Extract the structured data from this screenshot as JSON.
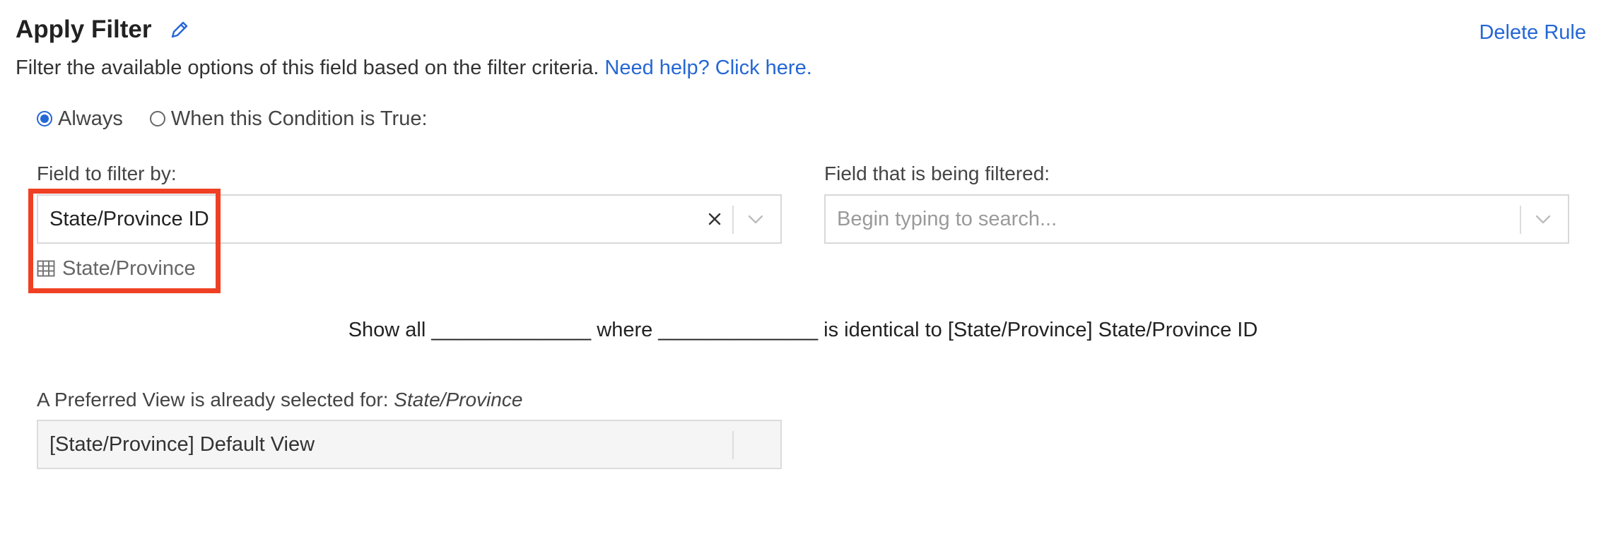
{
  "header": {
    "title": "Apply Filter",
    "edit_icon": "pencil-icon",
    "delete_label": "Delete Rule",
    "description": "Filter the available options of this field based on the filter criteria.",
    "help_link": "Need help? Click here."
  },
  "condition": {
    "options": [
      {
        "label": "Always",
        "checked": true
      },
      {
        "label": "When this Condition is True:",
        "checked": false
      }
    ]
  },
  "filter_by": {
    "label": "Field to filter by:",
    "value": "State/Province ID",
    "table_name": "State/Province",
    "table_icon": "table-grid-icon"
  },
  "filtered_field": {
    "label": "Field that is being filtered:",
    "placeholder": "Begin typing to search..."
  },
  "summary": {
    "part1": "Show all ",
    "blank1": "______________",
    "part2": " where ",
    "blank2": "______________",
    "part3": " is identical to [State/Province] State/Province ID"
  },
  "preferred_view": {
    "label_prefix": "A Preferred View is already selected for: ",
    "label_table": "State/Province",
    "value": "[State/Province] Default View"
  },
  "colors": {
    "accent": "#2567d5",
    "highlight": "#ef4023"
  }
}
